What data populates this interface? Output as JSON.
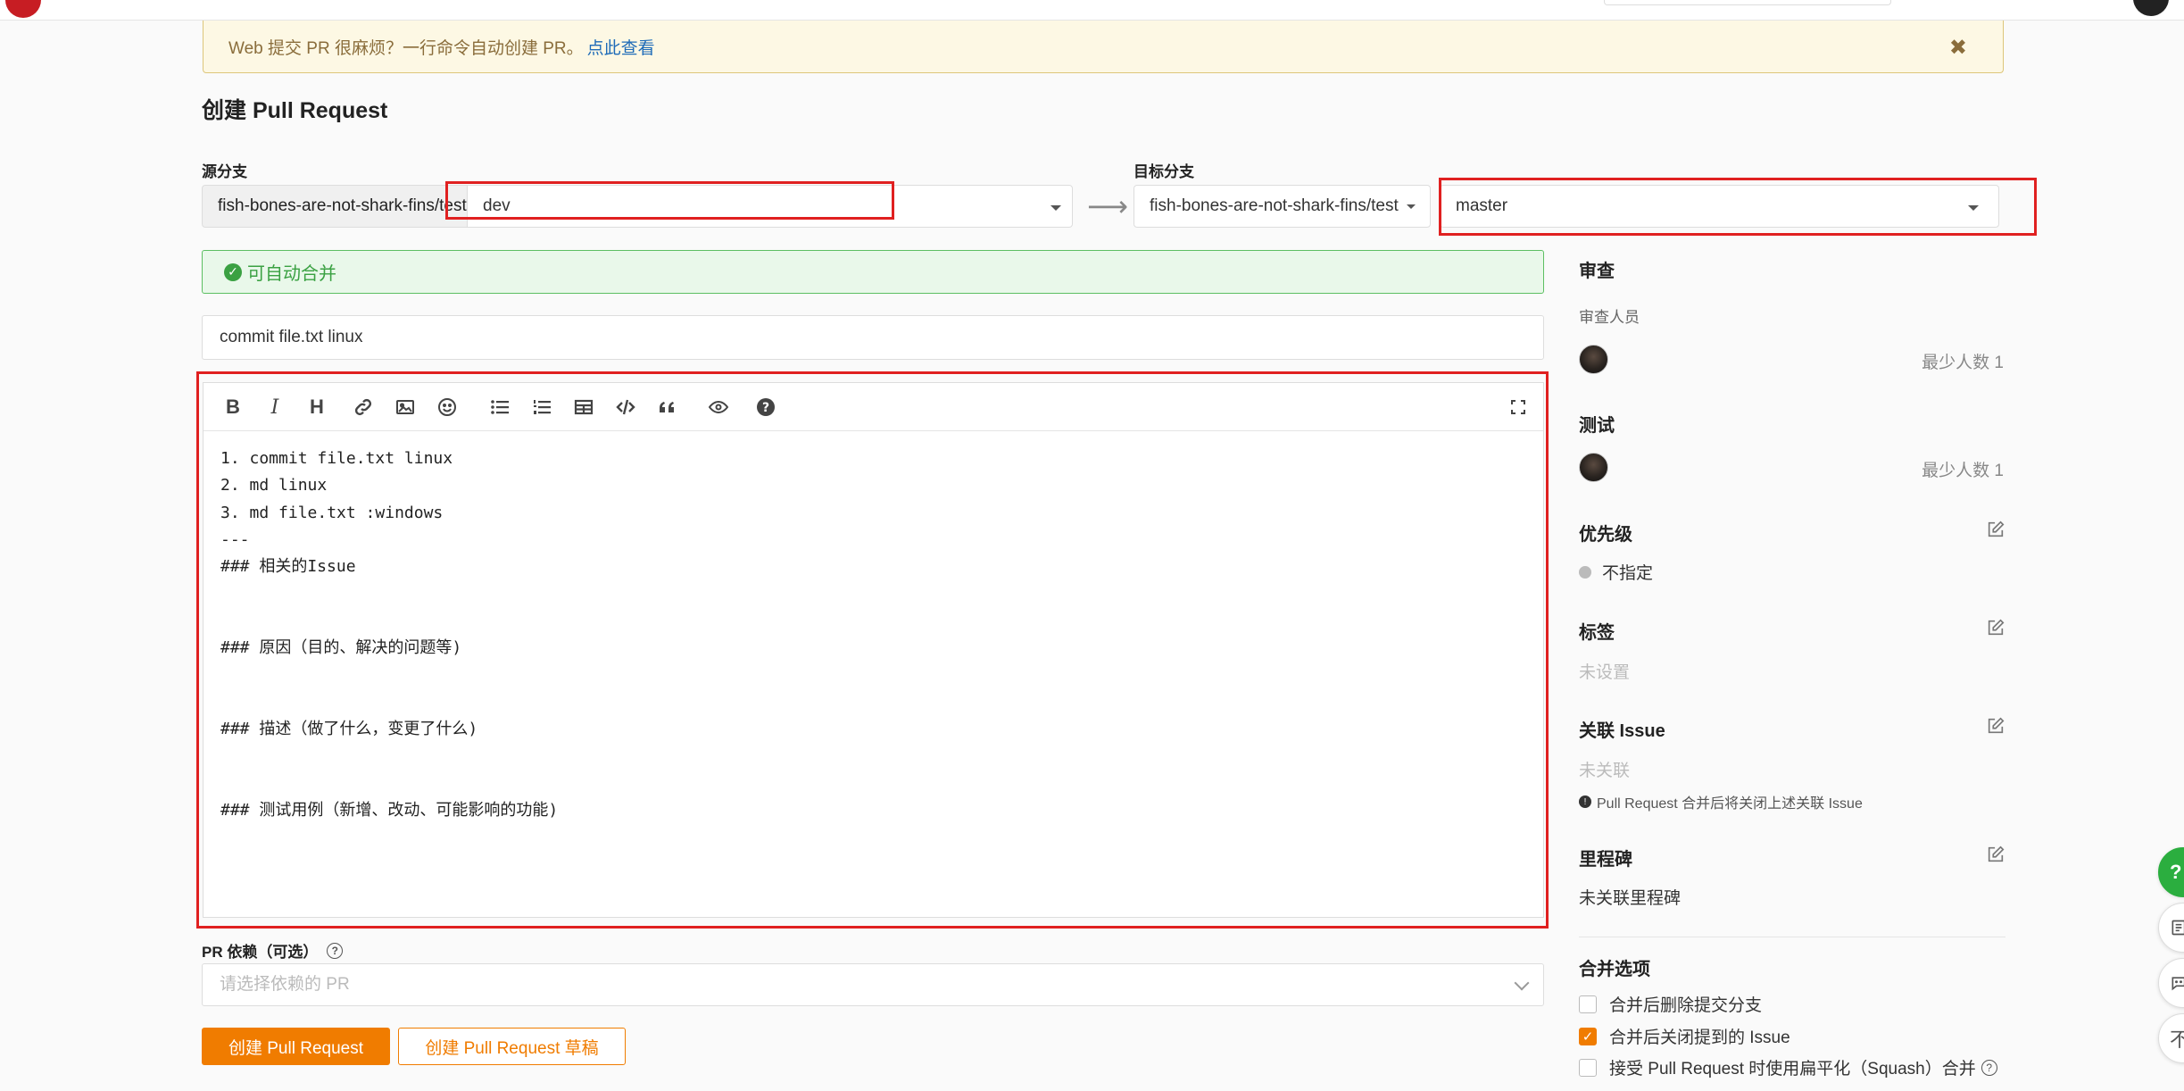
{
  "notice": {
    "text": "Web 提交 PR 很麻烦？一行命令自动创建 PR。",
    "link": "点此查看",
    "close": "✖"
  },
  "page_title": "创建 Pull Request",
  "source": {
    "label": "源分支",
    "repo": "fish-bones-are-not-shark-fins/test",
    "branch": "dev"
  },
  "target": {
    "label": "目标分支",
    "repo": "fish-bones-are-not-shark-fins/test",
    "branch": "master"
  },
  "merge_status": "可自动合并",
  "pr_title": "commit file.txt linux",
  "editor_body": "1. commit file.txt linux\n2. md linux\n3. md file.txt :windows\n---\n### 相关的Issue\n\n\n### 原因（目的、解决的问题等)\n\n\n### 描述（做了什么，变更了什么)\n\n\n### 测试用例（新增、改动、可能影响的功能)",
  "toolbar": {
    "bold": "B",
    "italic": "I",
    "heading": "H"
  },
  "dependency": {
    "label": "PR 依赖（可选）",
    "placeholder": "请选择依赖的 PR"
  },
  "buttons": {
    "create": "创建 Pull Request",
    "create_draft": "创建 Pull Request 草稿"
  },
  "sidebar": {
    "review_title": "审查",
    "reviewers_label": "审查人员",
    "reviewers_min": "最少人数 1",
    "test_title": "测试",
    "test_min": "最少人数 1",
    "priority_title": "优先级",
    "priority_value": "不指定",
    "labels_title": "标签",
    "labels_value": "未设置",
    "issue_title": "关联 Issue",
    "issue_value": "未关联",
    "issue_note": "Pull Request 合并后将关闭上述关联 Issue",
    "milestone_title": "里程碑",
    "milestone_value": "未关联里程碑",
    "merge_options_title": "合并选项",
    "options": [
      {
        "label": "合并后删除提交分支",
        "checked": false
      },
      {
        "label": "合并后关闭提到的 Issue",
        "checked": true
      },
      {
        "label": "接受 Pull Request 时使用扁平化（Squash）合并",
        "checked": false
      }
    ]
  },
  "float_buttons": [
    "?",
    "",
    "",
    "不"
  ],
  "colors": {
    "accent": "#f07c00",
    "success": "#3aa142",
    "highlight_box": "#e02020",
    "notice_bg": "#fdf8e4"
  }
}
